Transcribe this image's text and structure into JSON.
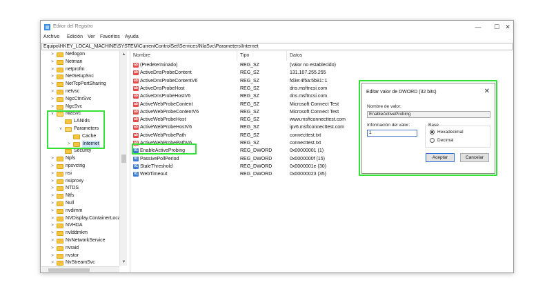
{
  "window": {
    "title": "Editor del Registro",
    "minimize": "—",
    "maximize": "☐",
    "close": "✕"
  },
  "menu": [
    "Archivo",
    "Edición",
    "Ver",
    "Favoritos",
    "Ayuda"
  ],
  "address": "Equipo\\HKEY_LOCAL_MACHINE\\SYSTEM\\CurrentControlSet\\Services\\NlaSvc\\Parameters\\Internet",
  "tree": [
    {
      "label": "Netlogon",
      "chev": ">"
    },
    {
      "label": "Netman",
      "chev": ">"
    },
    {
      "label": "netprofm",
      "chev": ">"
    },
    {
      "label": "NetSetupSvc",
      "chev": ">"
    },
    {
      "label": "NetTcpPortSharing",
      "chev": ">"
    },
    {
      "label": "netvsc",
      "chev": ">"
    },
    {
      "label": "NgcCtnrSvc",
      "chev": ">"
    },
    {
      "label": "NgcSvc",
      "chev": ">"
    },
    {
      "label": "NlaSvc",
      "chev": "v"
    },
    {
      "label": "LANIds",
      "chev": ""
    },
    {
      "label": "Parameters",
      "chev": "v"
    },
    {
      "label": "Cache",
      "chev": ""
    },
    {
      "label": "Internet",
      "chev": ">"
    },
    {
      "label": "Security",
      "chev": ""
    },
    {
      "label": "Npfs",
      "chev": ">"
    },
    {
      "label": "npsvctrig",
      "chev": ">"
    },
    {
      "label": "nsi",
      "chev": ">"
    },
    {
      "label": "nsiproxy",
      "chev": ">"
    },
    {
      "label": "NTDS",
      "chev": ">"
    },
    {
      "label": "Ntfs",
      "chev": ">"
    },
    {
      "label": "Null",
      "chev": ">"
    },
    {
      "label": "nvdimm",
      "chev": ">"
    },
    {
      "label": "NVDisplay.ContainerLocal",
      "chev": ">"
    },
    {
      "label": "NVHDA",
      "chev": ">"
    },
    {
      "label": "nvlddmkm",
      "chev": ">"
    },
    {
      "label": "NvNetworkService",
      "chev": ">"
    },
    {
      "label": "nvraid",
      "chev": ">"
    },
    {
      "label": "nvstor",
      "chev": ">"
    },
    {
      "label": "NvStreamSvc",
      "chev": ">"
    }
  ],
  "columns": {
    "name": "Nombre",
    "type": "Tipo",
    "data": "Datos"
  },
  "values": [
    {
      "name": "(Predeterminado)",
      "type": "REG_SZ",
      "data": "(valor no establecido)",
      "kind": "sz"
    },
    {
      "name": "ActiveDnsProbeContent",
      "type": "REG_SZ",
      "data": "131.107.255.255",
      "kind": "sz"
    },
    {
      "name": "ActiveDnsProbeContentV6",
      "type": "REG_SZ",
      "data": "fd3e:4f5a:5b81::1",
      "kind": "sz"
    },
    {
      "name": "ActiveDnsProbeHost",
      "type": "REG_SZ",
      "data": "dns.msftncsi.com",
      "kind": "sz"
    },
    {
      "name": "ActiveDnsProbeHostV6",
      "type": "REG_SZ",
      "data": "dns.msftncsi.com",
      "kind": "sz"
    },
    {
      "name": "ActiveWebProbeContent",
      "type": "REG_SZ",
      "data": "Microsoft Connect Test",
      "kind": "sz"
    },
    {
      "name": "ActiveWebProbeContentV6",
      "type": "REG_SZ",
      "data": "Microsoft Connect Test",
      "kind": "sz"
    },
    {
      "name": "ActiveWebProbeHost",
      "type": "REG_SZ",
      "data": "www.msftconnecttest.com",
      "kind": "sz"
    },
    {
      "name": "ActiveWebProbeHostV6",
      "type": "REG_SZ",
      "data": "ipv6.msftconnecttest.com",
      "kind": "sz"
    },
    {
      "name": "ActiveWebProbePath",
      "type": "REG_SZ",
      "data": "connecttest.txt",
      "kind": "sz"
    },
    {
      "name": "ActiveWebProbePathV6",
      "type": "REG_SZ",
      "data": "connecttest.txt",
      "kind": "sz"
    },
    {
      "name": "EnableActiveProbing",
      "type": "REG_DWORD",
      "data": "0x00000001 (1)",
      "kind": "dw"
    },
    {
      "name": "PassivePollPeriod",
      "type": "REG_DWORD",
      "data": "0x0000000f (15)",
      "kind": "dw"
    },
    {
      "name": "StaleThreshold",
      "type": "REG_DWORD",
      "data": "0x0000001e (30)",
      "kind": "dw"
    },
    {
      "name": "WebTimeout",
      "type": "REG_DWORD",
      "data": "0x00000023 (35)",
      "kind": "dw"
    }
  ],
  "dialog": {
    "title": "Editar valor de DWORD (32 bits)",
    "close": "✕",
    "name_label": "Nombre de valor:",
    "name_value": "EnableActiveProbing",
    "data_label": "Información del valor:",
    "data_value": "1",
    "base_label": "Base",
    "hex_label": "Hexadecimal",
    "dec_label": "Decimal",
    "hex_selected": true,
    "ok_label": "Aceptar",
    "cancel_label": "Cancelar"
  },
  "colors": {
    "highlight": "#35e035",
    "string_icon": "#e84a4a",
    "dword_icon": "#3b7ad6"
  }
}
